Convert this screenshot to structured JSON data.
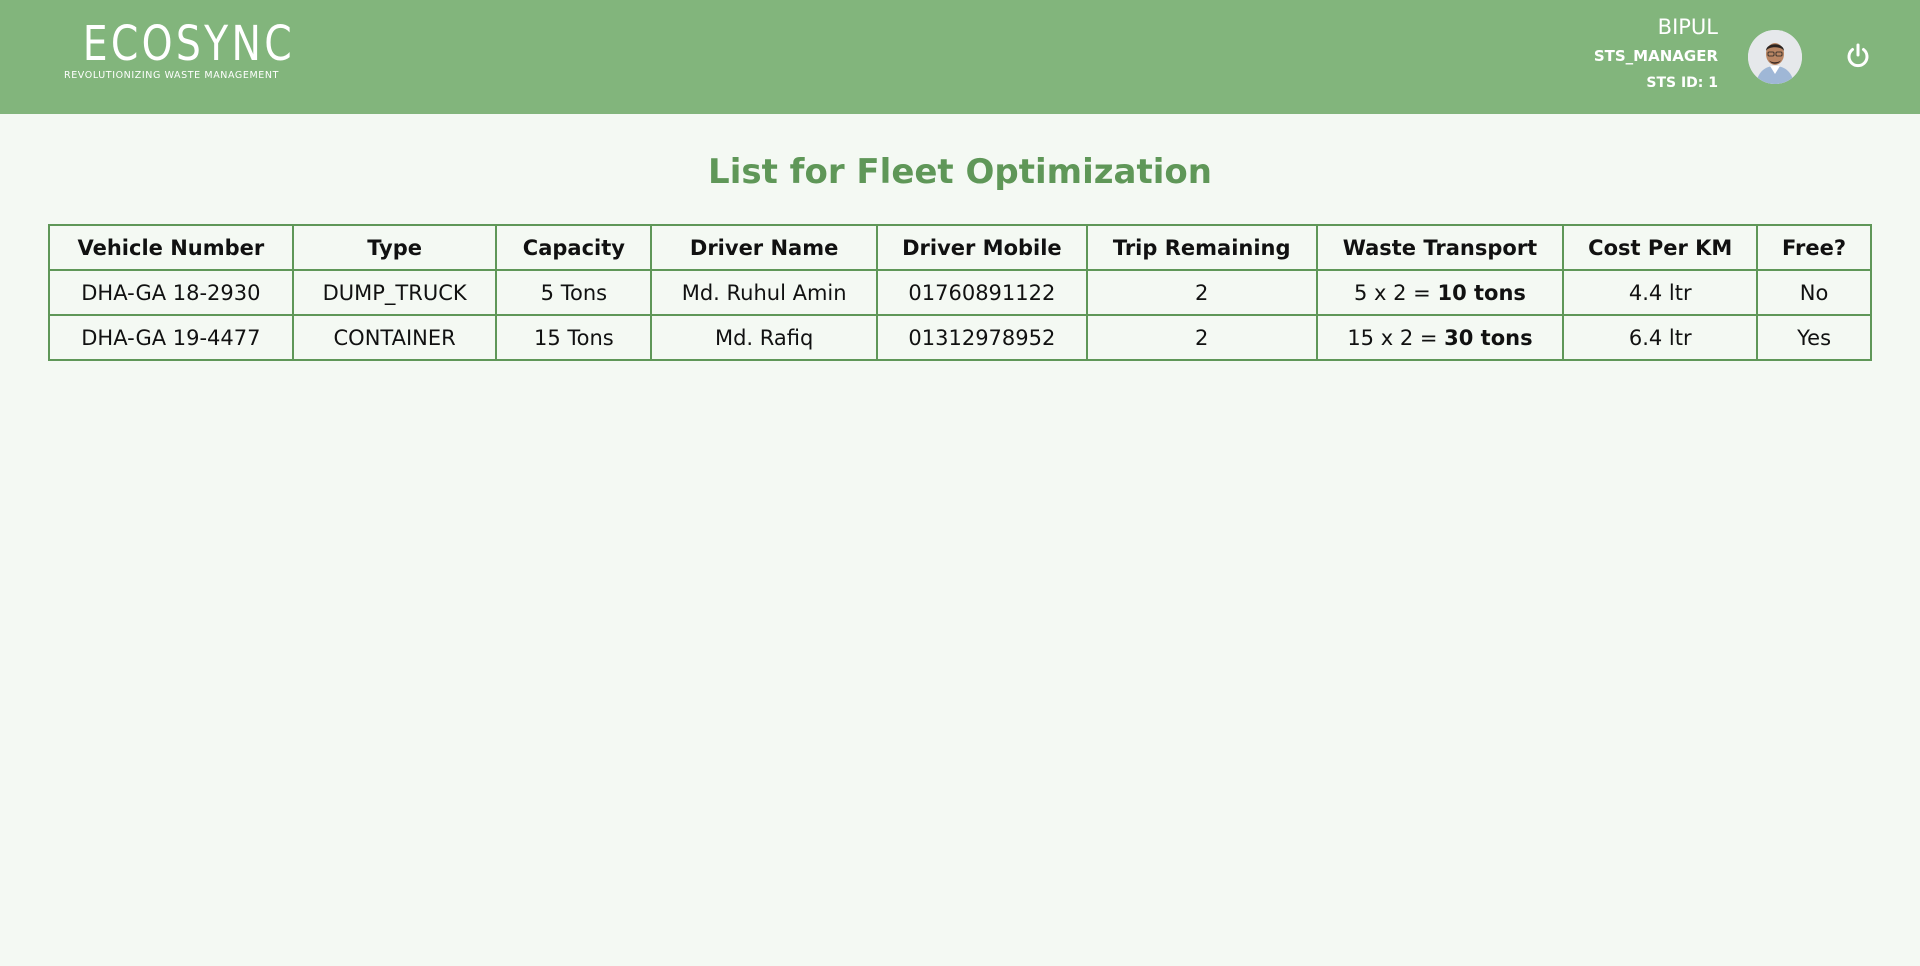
{
  "header": {
    "logo": {
      "word": "ECOSYNC",
      "tagline": "REVOLUTIONIZING WASTE MANAGEMENT"
    },
    "user": {
      "name": "BIPUL",
      "role": "STS_MANAGER",
      "sts_id": "STS ID: 1"
    },
    "avatar_icon": "user-avatar-photo",
    "logout_icon": "power-icon"
  },
  "page": {
    "title": "List for Fleet Optimization"
  },
  "table": {
    "headers": [
      "Vehicle Number",
      "Type",
      "Capacity",
      "Driver Name",
      "Driver Mobile",
      "Trip Remaining",
      "Waste Transport",
      "Cost Per KM",
      "Free?"
    ],
    "rows": [
      {
        "vehicle_number": "DHA-GA 18-2930",
        "type": "DUMP_TRUCK",
        "capacity": "5 Tons",
        "driver_name": "Md. Ruhul Amin",
        "driver_mobile": "01760891122",
        "trip_remaining": "2",
        "waste_transport_formula": "5 x 2 = ",
        "waste_transport_total": "10 tons",
        "cost_per_km": "4.4 ltr",
        "free": "No"
      },
      {
        "vehicle_number": "DHA-GA 19-4477",
        "type": "CONTAINER",
        "capacity": "15 Tons",
        "driver_name": "Md. Rafiq",
        "driver_mobile": "01312978952",
        "trip_remaining": "2",
        "waste_transport_formula": "15 x 2 = ",
        "waste_transport_total": "30 tons",
        "cost_per_km": "6.4 ltr",
        "free": "Yes"
      }
    ]
  },
  "colors": {
    "header_bg": "#82b57c",
    "accent": "#5f9758",
    "page_bg": "#f4f9f3"
  }
}
